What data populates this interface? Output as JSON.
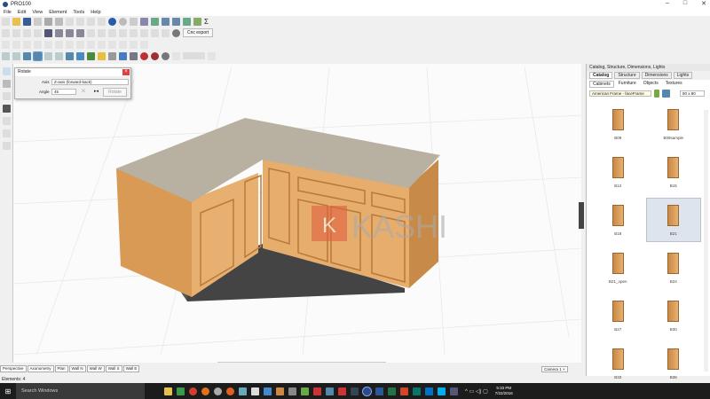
{
  "app": {
    "title": "PRO100",
    "status": "Elements: 4"
  },
  "menu": [
    "File",
    "Edit",
    "View",
    "Element",
    "Tools",
    "Help"
  ],
  "toolbar": {
    "cnc_export": "Cnc export"
  },
  "rotate_dialog": {
    "title": "Rotate",
    "axis_label": "Axis",
    "axis_value": "Z-axis (forward-back)",
    "angle_label": "Angle",
    "angle_value": "45",
    "rotate_button": "Rotate"
  },
  "view_tabs": [
    "Perspective",
    "Axonometry",
    "Plan",
    "Wall N",
    "Wall W",
    "Wall S",
    "Wall E"
  ],
  "camera_tab": "Camera 1",
  "watermark": "KASHI",
  "panel": {
    "title": "Catalog, Structure, Dimensions, Lights",
    "tabs": [
      "Catalog",
      "Structure",
      "Dimensions",
      "Lights"
    ],
    "subtabs": [
      "Cabinets",
      "Furniture",
      "Objects",
      "Textures"
    ],
    "library": "American Frame - faceFrame",
    "size": "80 x 80",
    "items": [
      {
        "label": "B09"
      },
      {
        "label": "B09sample"
      },
      {
        "label": "B12"
      },
      {
        "label": "B15"
      },
      {
        "label": "B18"
      },
      {
        "label": "B21",
        "selected": true
      },
      {
        "label": "B21_open"
      },
      {
        "label": "B24"
      },
      {
        "label": "B27"
      },
      {
        "label": "B30"
      },
      {
        "label": "B33"
      },
      {
        "label": "B36"
      }
    ]
  },
  "taskbar": {
    "search": "Search Windows",
    "time": "5:33 PM",
    "date": "7/22/2016"
  }
}
